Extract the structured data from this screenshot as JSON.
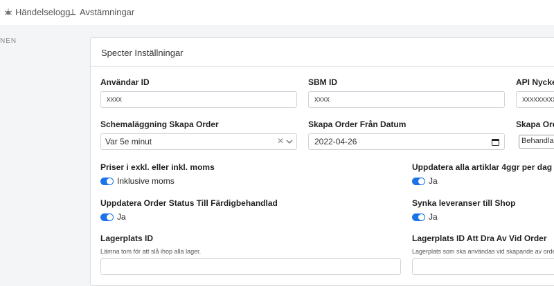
{
  "nav": {
    "event_log": "Händelselogg",
    "reconciliations": "Avstämningar"
  },
  "sidebar": {
    "section_label": "NEN"
  },
  "card": {
    "title": "Specter Inställningar",
    "user_id": {
      "label": "Användar ID",
      "value": "xxxx"
    },
    "sbm_id": {
      "label": "SBM ID",
      "value": "xxxx"
    },
    "api_key": {
      "label": "API Nyckel",
      "value": "xxxxxxxxxx"
    },
    "schedule": {
      "label": "Schemaläggning Skapa Order",
      "value": "Var 5e minut"
    },
    "from_date": {
      "label": "Skapa Order Från Datum",
      "value": "2022-04-26"
    },
    "create_status": {
      "label": "Skapa Orde",
      "value": "Behandlas"
    },
    "prices": {
      "label": "Priser i exkl. eller inkl. moms",
      "value": "Inklusive moms"
    },
    "update_articles": {
      "label": "Uppdatera alla artiklar 4ggr per dag",
      "value": "Ja"
    },
    "update_status": {
      "label": "Uppdatera Order Status Till Färdigbehandlad",
      "value": "Ja"
    },
    "sync_deliveries": {
      "label": "Synka leveranser till Shop",
      "value": "Ja"
    },
    "warehouse_id": {
      "label": "Lagerplats ID",
      "help": "Lämna tom för att slå ihop alla lager.",
      "value": ""
    },
    "warehouse_pull": {
      "label": "Lagerplats ID Att Dra Av Vid Order",
      "help": "Lagerplats som ska användas vid skapande av order.",
      "value": ""
    }
  },
  "colors": {
    "toggle_on": "#1a73e8",
    "border": "#cfd4da"
  }
}
